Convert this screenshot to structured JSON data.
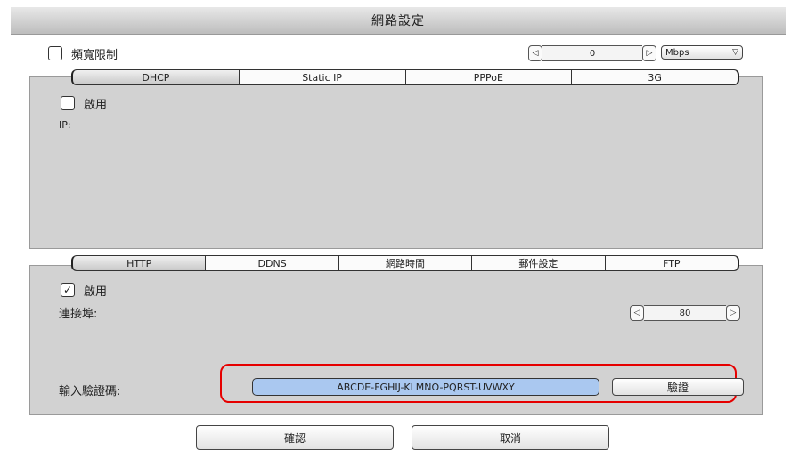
{
  "dialog": {
    "title": "網路設定"
  },
  "bandwidth": {
    "label": "頻寬限制",
    "checked": false,
    "value": "0",
    "unit": "Mbps",
    "dec_symbol": "◁",
    "inc_symbol": "▷",
    "dropdown_symbol": "▽"
  },
  "top_tabs": [
    {
      "label": "DHCP",
      "active": true
    },
    {
      "label": "Static IP",
      "active": false
    },
    {
      "label": "PPPoE",
      "active": false
    },
    {
      "label": "3G",
      "active": false
    }
  ],
  "dhcp": {
    "enable_label": "啟用",
    "enabled": false,
    "ip_label": "IP:"
  },
  "bottom_tabs": [
    {
      "label": "HTTP",
      "active": true
    },
    {
      "label": "DDNS",
      "active": false
    },
    {
      "label": "網路時間",
      "active": false
    },
    {
      "label": "郵件設定",
      "active": false
    },
    {
      "label": "FTP",
      "active": false
    }
  ],
  "http": {
    "enable_label": "啟用",
    "enabled": true,
    "enabled_mark": "✓",
    "port_label": "連接埠:",
    "port_value": "80",
    "dec_symbol": "◁",
    "inc_symbol": "▷",
    "pass_label": "輸入驗證碼:",
    "pass_value": "ABCDE-FGHIJ-KLMNO-PQRST-UVWXY",
    "verify_button": "驗證"
  },
  "footer": {
    "ok_button": "確認",
    "cancel_button": "取消"
  },
  "colors": {
    "highlight": "#e60000",
    "input_fill": "#aac8f0"
  }
}
